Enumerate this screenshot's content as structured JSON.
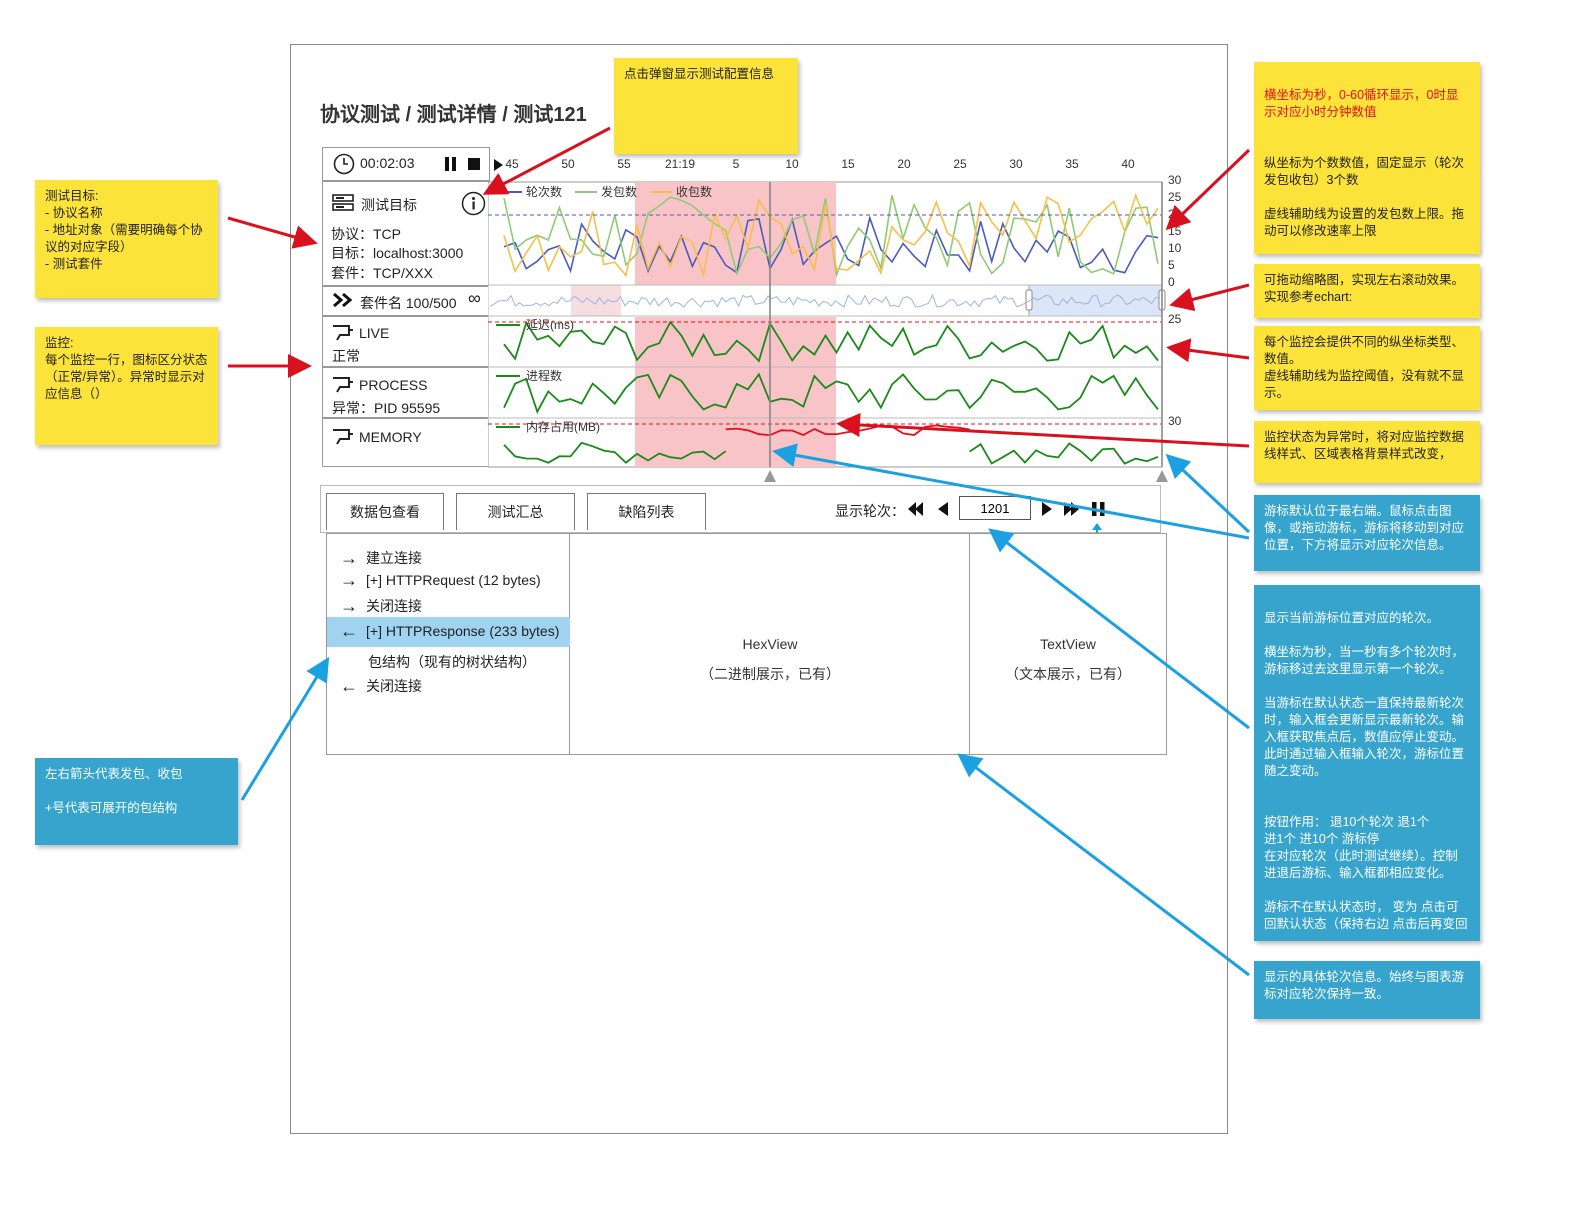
{
  "breadcrumb": "协议测试 / 测试详情 / 测试121",
  "timer": {
    "time": "00:02:03"
  },
  "timeline": {
    "ticks": [
      "45",
      "50",
      "55",
      "21:19",
      "5",
      "10",
      "15",
      "20",
      "25",
      "30",
      "35",
      "40"
    ]
  },
  "chart_data": [
    {
      "type": "line",
      "title": "",
      "series": [
        {
          "name": "轮次数",
          "color": "#4a5bbd"
        },
        {
          "name": "发包数",
          "color": "#8fcb74"
        },
        {
          "name": "收包数",
          "color": "#f4c04a"
        }
      ],
      "yticks": [
        "30",
        "25",
        "20",
        "15",
        "10",
        "5",
        "0"
      ],
      "threshold_line": "dashed blue",
      "highlight_band": "red"
    },
    {
      "type": "line",
      "series": [
        {
          "name": "延迟(ms)",
          "color": "#1a8a1a"
        }
      ],
      "ytop": "25",
      "threshold_line": "dashed red"
    },
    {
      "type": "line",
      "series": [
        {
          "name": "进程数",
          "color": "#1a8a1a"
        }
      ]
    },
    {
      "type": "line",
      "series": [
        {
          "name": "内存占用(MB)",
          "color": "#1a8a1a",
          "abnormal_color": "#e3101e"
        }
      ],
      "ytop": "30",
      "threshold_line": "dashed red"
    }
  ],
  "target": {
    "title": "测试目标",
    "protocol": "协议：TCP",
    "address": "目标：localhost:3000",
    "suite": "套件：TCP/XXX",
    "suite_progress": "套件名 100/500",
    "loop_icon": "∞"
  },
  "monitors": [
    {
      "name": "LIVE",
      "status": "正常",
      "icon": "monitor-icon"
    },
    {
      "name": "PROCESS",
      "status": "异常：PID 95595",
      "icon": "monitor-icon"
    },
    {
      "name": "MEMORY",
      "status": "",
      "icon": "monitor-icon"
    }
  ],
  "tabs": [
    "数据包查看",
    "测试汇总",
    "缺陷列表"
  ],
  "round": {
    "label": "显示轮次：",
    "value": "1201"
  },
  "packets": [
    {
      "dir": "→",
      "text": "建立连接"
    },
    {
      "dir": "→",
      "text": "[+] HTTPRequest (12 bytes)"
    },
    {
      "dir": "→",
      "text": "关闭连接"
    },
    {
      "dir": "←",
      "text": "[+] HTTPResponse (233 bytes)"
    },
    {
      "dir": "",
      "text": "包结构（现有的树状结构）"
    },
    {
      "dir": "←",
      "text": "关闭连接"
    }
  ],
  "hexview": {
    "title": "HexView",
    "desc": "（二进制展示，已有）"
  },
  "textview": {
    "title": "TextView",
    "desc": "（文本展示，已有）"
  },
  "notes": {
    "config": "点击弹窗显示测试配置信息",
    "target": "测试目标:\n- 协议名称\n- 地址对象（需要明确每个协议的对应字段）\n- 测试套件",
    "monitor": "监控:\n每个监控一行，图标区分状态（正常/异常）。异常时显示对应信息（）",
    "axis_red": "横坐标为秒，0-60循环显示，0时显示对应小时分钟数值",
    "axis_rest": "纵坐标为个数数值，固定显示（轮次发包收包）3个数\n\n虚线辅助线为设置的发包数上限。拖动可以修改速率上限",
    "thumb": "可拖动缩略图，实现左右滚动效果。实现参考echart:",
    "ytypes": "每个监控会提供不同的纵坐标类型、数值。\n虚线辅助线为监控阈值，没有就不显示。",
    "abnormal": "监控状态为异常时，将对应监控数据线样式、区域表格背景样式改变，",
    "cursor": "游标默认位于最右端。鼠标点击图像，或拖动游标，游标将移动到对应位置，下方将显示对应轮次信息。",
    "round_info": "显示当前游标位置对应的轮次。\n\n横坐标为秒，当一秒有多个轮次时，游标移过去这里显示第一个轮次。\n\n当游标在默认状态一直保持最新轮次时，输入框会更新显示最新轮次。输入框获取焦点后，数值应停止变动。此时通过输入框输入轮次，游标位置随之变动。",
    "buttons": "按钮作用：  退10个轮次  退1个\n进1个  进10个  游标停\n在对应轮次（此时测试继续）。控制进退后游标、输入框都相应变化。\n\n游标不在默认状态时，  变为  点击可回默认状态（保持右边  点击后再变回",
    "detail": "显示的具体轮次信息。始终与图表游标对应轮次保持一致。",
    "arrows": "左右箭头代表发包、收包\n\n+号代表可展开的包结构"
  }
}
